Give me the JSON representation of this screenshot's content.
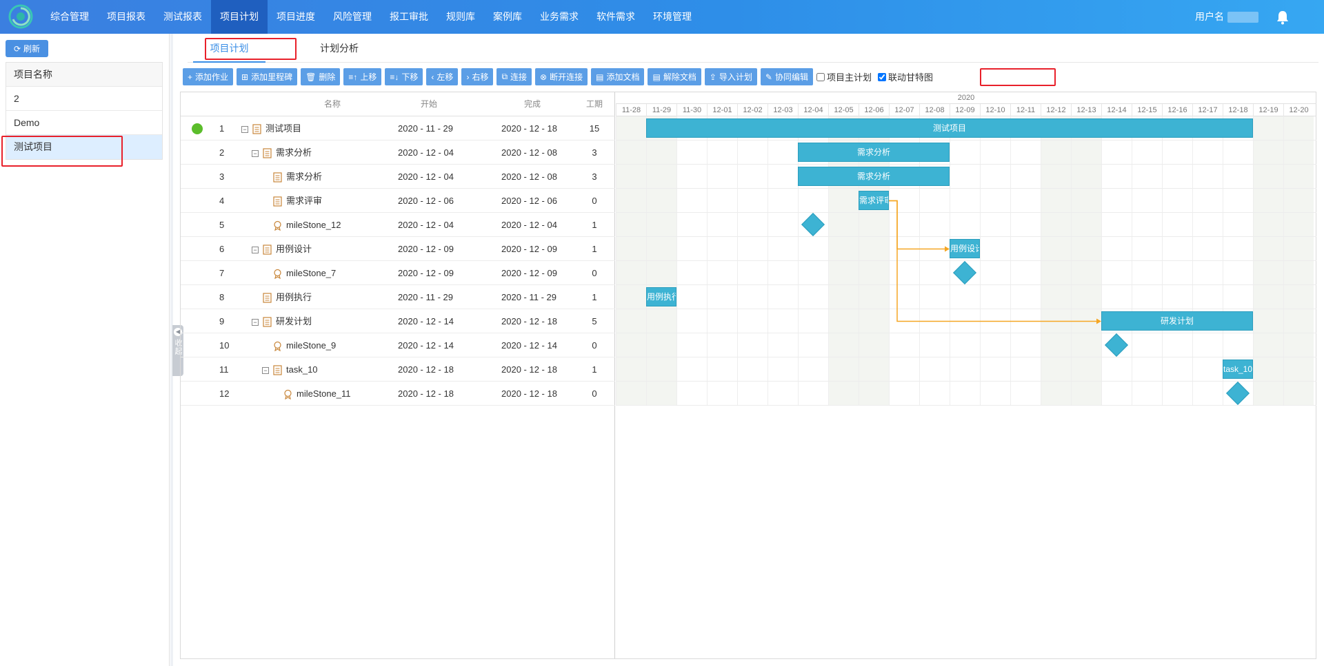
{
  "nav": {
    "items": [
      "综合管理",
      "项目报表",
      "测试报表",
      "项目计划",
      "项目进度",
      "风险管理",
      "报工审批",
      "规则库",
      "案例库",
      "业务需求",
      "软件需求",
      "环境管理"
    ],
    "active_index": 3,
    "username_label": "用户名"
  },
  "sidebar": {
    "refresh_label": "刷新",
    "header": "项目名称",
    "projects": [
      "2",
      "Demo",
      "测试项目"
    ],
    "selected_index": 2,
    "collapse_label": "收起"
  },
  "tabs": {
    "items": [
      "项目计划",
      "计划分析"
    ],
    "active_index": 0
  },
  "toolbar": {
    "buttons": [
      {
        "icon": "plus-icon",
        "label": "添加作业"
      },
      {
        "icon": "milestone-add-icon",
        "label": "添加里程碑"
      },
      {
        "icon": "trash-icon",
        "label": "删除"
      },
      {
        "icon": "move-up-icon",
        "label": "上移"
      },
      {
        "icon": "move-down-icon",
        "label": "下移"
      },
      {
        "icon": "chevron-left-icon",
        "label": "左移"
      },
      {
        "icon": "chevron-right-icon",
        "label": "右移"
      },
      {
        "icon": "link-icon",
        "label": "连接"
      },
      {
        "icon": "unlink-icon",
        "label": "断开连接"
      },
      {
        "icon": "doc-add-icon",
        "label": "添加文档"
      },
      {
        "icon": "doc-remove-icon",
        "label": "解除文档"
      },
      {
        "icon": "import-icon",
        "label": "导入计划"
      },
      {
        "icon": "collab-icon",
        "label": "协同编辑"
      }
    ],
    "master_plan_label": "项目主计划",
    "master_plan_checked": false,
    "link_gantt_label": "联动甘特图",
    "link_gantt_checked": true
  },
  "grid": {
    "columns": {
      "name": "名称",
      "start": "开始",
      "end": "完成",
      "duration": "工期"
    },
    "rows": [
      {
        "id": "1",
        "name": "测试项目",
        "start": "2020 - 11 - 29",
        "end": "2020 - 12 - 18",
        "duration": "15",
        "level": 0,
        "kind": "project",
        "toggle": true
      },
      {
        "id": "2",
        "name": "需求分析",
        "start": "2020 - 12 - 04",
        "end": "2020 - 12 - 08",
        "duration": "3",
        "level": 1,
        "kind": "summary",
        "toggle": true
      },
      {
        "id": "3",
        "name": "需求分析",
        "start": "2020 - 12 - 04",
        "end": "2020 - 12 - 08",
        "duration": "3",
        "level": 2,
        "kind": "task",
        "toggle": false
      },
      {
        "id": "4",
        "name": "需求评审",
        "start": "2020 - 12 - 06",
        "end": "2020 - 12 - 06",
        "duration": "0",
        "level": 2,
        "kind": "task",
        "toggle": false
      },
      {
        "id": "5",
        "name": "mileStone_12",
        "start": "2020 - 12 - 04",
        "end": "2020 - 12 - 04",
        "duration": "1",
        "level": 2,
        "kind": "milestone",
        "toggle": false
      },
      {
        "id": "6",
        "name": "用例设计",
        "start": "2020 - 12 - 09",
        "end": "2020 - 12 - 09",
        "duration": "1",
        "level": 1,
        "kind": "summary",
        "toggle": true
      },
      {
        "id": "7",
        "name": "mileStone_7",
        "start": "2020 - 12 - 09",
        "end": "2020 - 12 - 09",
        "duration": "0",
        "level": 2,
        "kind": "milestone",
        "toggle": false
      },
      {
        "id": "8",
        "name": "用例执行",
        "start": "2020 - 11 - 29",
        "end": "2020 - 11 - 29",
        "duration": "1",
        "level": 1,
        "kind": "task",
        "toggle": false
      },
      {
        "id": "9",
        "name": "研发计划",
        "start": "2020 - 12 - 14",
        "end": "2020 - 12 - 18",
        "duration": "5",
        "level": 1,
        "kind": "summary",
        "toggle": true
      },
      {
        "id": "10",
        "name": "mileStone_9",
        "start": "2020 - 12 - 14",
        "end": "2020 - 12 - 14",
        "duration": "0",
        "level": 2,
        "kind": "milestone",
        "toggle": false
      },
      {
        "id": "11",
        "name": "task_10",
        "start": "2020 - 12 - 18",
        "end": "2020 - 12 - 18",
        "duration": "1",
        "level": 2,
        "kind": "summary",
        "toggle": true
      },
      {
        "id": "12",
        "name": "mileStone_11",
        "start": "2020 - 12 - 18",
        "end": "2020 - 12 - 18",
        "duration": "0",
        "level": 3,
        "kind": "milestone",
        "toggle": false
      }
    ]
  },
  "gantt": {
    "year": "2020",
    "days": [
      "11-28",
      "11-29",
      "11-30",
      "12-01",
      "12-02",
      "12-03",
      "12-04",
      "12-05",
      "12-06",
      "12-07",
      "12-08",
      "12-09",
      "12-10",
      "12-11",
      "12-12",
      "12-13",
      "12-14",
      "12-15",
      "12-16",
      "12-17",
      "12-18",
      "12-19",
      "12-20"
    ],
    "weekend_days": [
      "11-28",
      "11-29",
      "12-05",
      "12-06",
      "12-12",
      "12-13",
      "12-19",
      "12-20"
    ],
    "bars": [
      {
        "row": 0,
        "type": "bar",
        "start": "11-29",
        "end": "12-18",
        "label": "测试项目"
      },
      {
        "row": 1,
        "type": "bar",
        "start": "12-04",
        "end": "12-08",
        "label": "需求分析"
      },
      {
        "row": 2,
        "type": "bar",
        "start": "12-04",
        "end": "12-08",
        "label": "需求分析"
      },
      {
        "row": 3,
        "type": "bar",
        "start": "12-06",
        "end": "12-06",
        "label": "需求评审"
      },
      {
        "row": 4,
        "type": "milestone",
        "start": "12-04"
      },
      {
        "row": 5,
        "type": "bar",
        "start": "12-09",
        "end": "12-09",
        "label": "用例设计"
      },
      {
        "row": 6,
        "type": "milestone",
        "start": "12-09"
      },
      {
        "row": 7,
        "type": "bar",
        "start": "11-29",
        "end": "11-29",
        "label": "用例执行"
      },
      {
        "row": 8,
        "type": "bar",
        "start": "12-14",
        "end": "12-18",
        "label": "研发计划"
      },
      {
        "row": 9,
        "type": "milestone",
        "start": "12-14"
      },
      {
        "row": 10,
        "type": "bar",
        "start": "12-18",
        "end": "12-18",
        "label": "task_10"
      },
      {
        "row": 11,
        "type": "milestone",
        "start": "12-18"
      }
    ],
    "links": [
      {
        "from_row": 3,
        "to_row": 5
      },
      {
        "from_row": 3,
        "to_row": 8
      }
    ],
    "colors": {
      "bar": "#3db3d3",
      "link": "#f5a623",
      "nav": "#3b7fe0",
      "highlight": "#e8202a"
    }
  }
}
